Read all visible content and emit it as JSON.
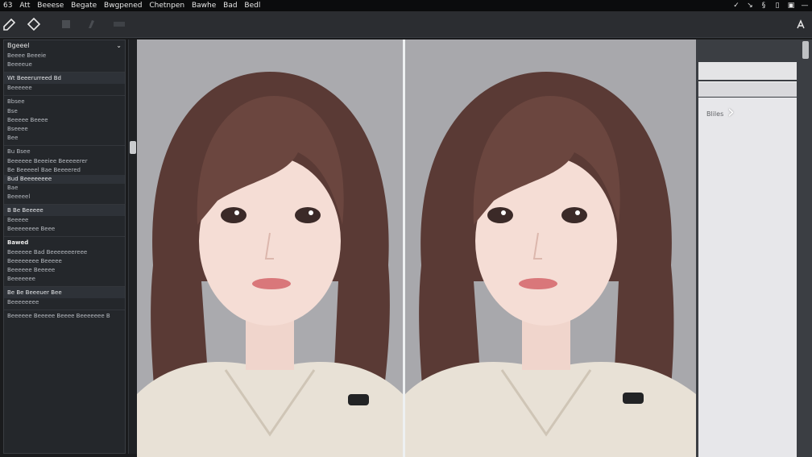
{
  "menubar": {
    "items": [
      "63",
      "Att",
      "Beeese",
      "Begate",
      "Bwgpened",
      "Chetnpen",
      "Bawhe",
      "Bad",
      "Bedl"
    ],
    "right_icons": [
      "check-icon",
      "arrow-icon",
      "clip-icon",
      "file-icon",
      "window-icon",
      "minimize-icon"
    ]
  },
  "toolbar": {
    "tools": [
      "pen-tool-icon",
      "eraser-tool-icon",
      "select-tool-icon",
      "brush-tool-icon",
      "move-tool-icon"
    ],
    "right_tool": "font-tool-icon"
  },
  "sidebar": {
    "header": "Bgeeel",
    "items": [
      "Beeee Beeeie",
      "Beeeeue",
      "Wt Beeerurreed Bd",
      "Beeeeee",
      "Bbsee",
      "Bse",
      "Beeeee Beeee",
      "Bseeee",
      "Bee",
      "Bu Bsee",
      "Beeeeee Beeeiee Beeeeerer",
      "Be Beeeeel Bae Beeeered",
      "Bud Beeeeeeee",
      "Bae",
      "Beeeeel",
      "B Be Beeeee",
      "Beeeee",
      "Beeeeeeee Beee",
      "Bawed",
      "Beeeeee Bad Beeeeeeereee",
      "Beeeeeeee Beeeee",
      "Beeeeee Beeeee",
      "Beeeeeee",
      "Be Be Beeeuer Bee",
      "Beeeeeeee",
      "Beeeeee Beeeee Beeee Beeeeeee B"
    ]
  },
  "canvas": {
    "panes": [
      "left-portrait",
      "right-portrait"
    ]
  },
  "right_panel": {
    "label": "Bliles"
  },
  "colors": {
    "background": "#1a1b1d",
    "toolbar": "#2b2d31",
    "canvas": "#a9a9ad",
    "panel": "#e7e7ea"
  }
}
